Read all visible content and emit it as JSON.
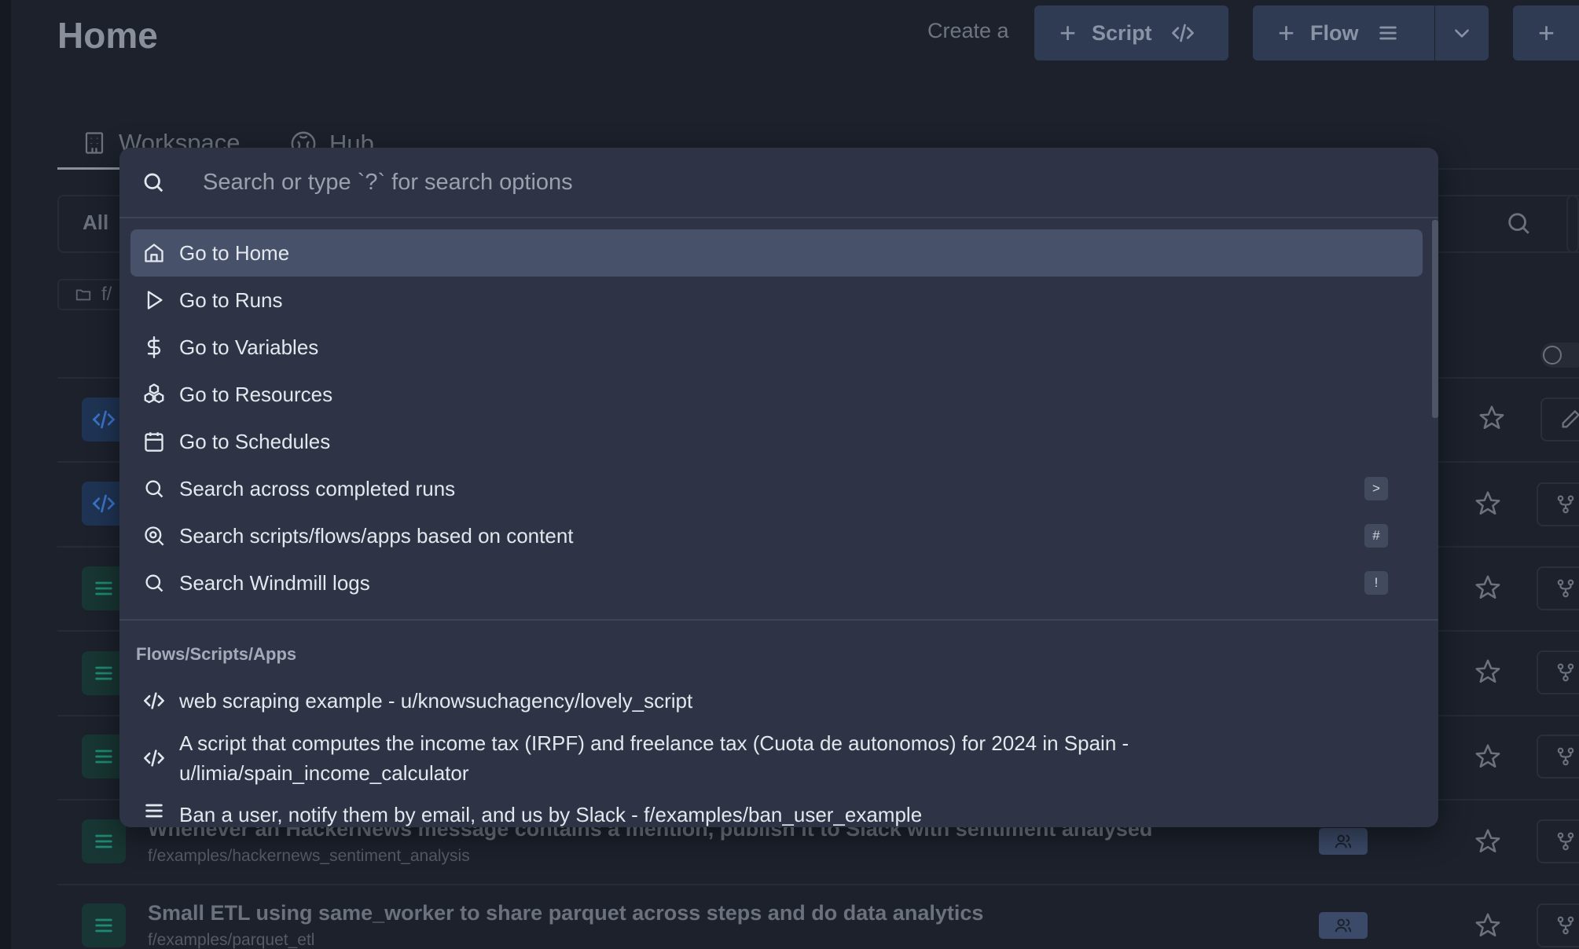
{
  "header": {
    "title": "Home",
    "create_label": "Create a",
    "script_button": "Script",
    "flow_button": "Flow",
    "third_button": "+"
  },
  "tabs": [
    {
      "label": "Workspace",
      "icon": "building-icon",
      "active": true
    },
    {
      "label": "Hub",
      "icon": "hub-icon",
      "active": false
    }
  ],
  "filter": {
    "all_label": "All",
    "folder_chip": "f/"
  },
  "palette": {
    "search_placeholder": "Search or type `?` for search options",
    "commands": [
      {
        "label": "Go to Home",
        "icon": "home-icon",
        "selected": true
      },
      {
        "label": "Go to Runs",
        "icon": "play-icon"
      },
      {
        "label": "Go to Variables",
        "icon": "dollar-icon"
      },
      {
        "label": "Go to Resources",
        "icon": "boxes-icon"
      },
      {
        "label": "Go to Schedules",
        "icon": "calendar-icon"
      },
      {
        "label": "Search across completed runs",
        "icon": "search-icon",
        "shortcut": ">"
      },
      {
        "label": "Search scripts/flows/apps based on content",
        "icon": "search-content-icon",
        "shortcut": "#"
      },
      {
        "label": "Search Windmill logs",
        "icon": "search-icon",
        "shortcut": "!"
      }
    ],
    "section_title": "Flows/Scripts/Apps",
    "results": [
      {
        "icon": "code-icon",
        "text": "web scraping example - u/knowsuchagency/lovely_script"
      },
      {
        "icon": "code-icon",
        "text": "A script that computes the income tax (IRPF) and freelance tax (Cuota de autonomos) for 2024 in Spain - u/limia/spain_income_calculator"
      },
      {
        "icon": "flow-icon",
        "text": "Ban a user, notify them by email, and us by Slack - f/examples/ban_user_example"
      }
    ]
  },
  "background_rows": [
    {
      "type": "script",
      "title": "",
      "path": ""
    },
    {
      "type": "script",
      "title": "",
      "path": ""
    },
    {
      "type": "flow",
      "title": "",
      "path": ""
    },
    {
      "type": "flow",
      "title": "",
      "path": ""
    },
    {
      "type": "flow",
      "title": "",
      "path": ""
    },
    {
      "type": "flow",
      "title": "Whenever an HackerNews message contains a mention, publish it to Slack with sentiment analysed",
      "path": "f/examples/hackernews_sentiment_analysis"
    },
    {
      "type": "flow",
      "title": "Small ETL using same_worker to share parquet across steps and do data analytics",
      "path": "f/examples/parquet_etl"
    }
  ],
  "colors": {
    "background": "#1c212c",
    "palette": "#2e3445",
    "selected_item": "#47526a",
    "button": "#2f3b52",
    "flow_accent": "#1f8a73",
    "script_accent": "#3b73c9"
  }
}
